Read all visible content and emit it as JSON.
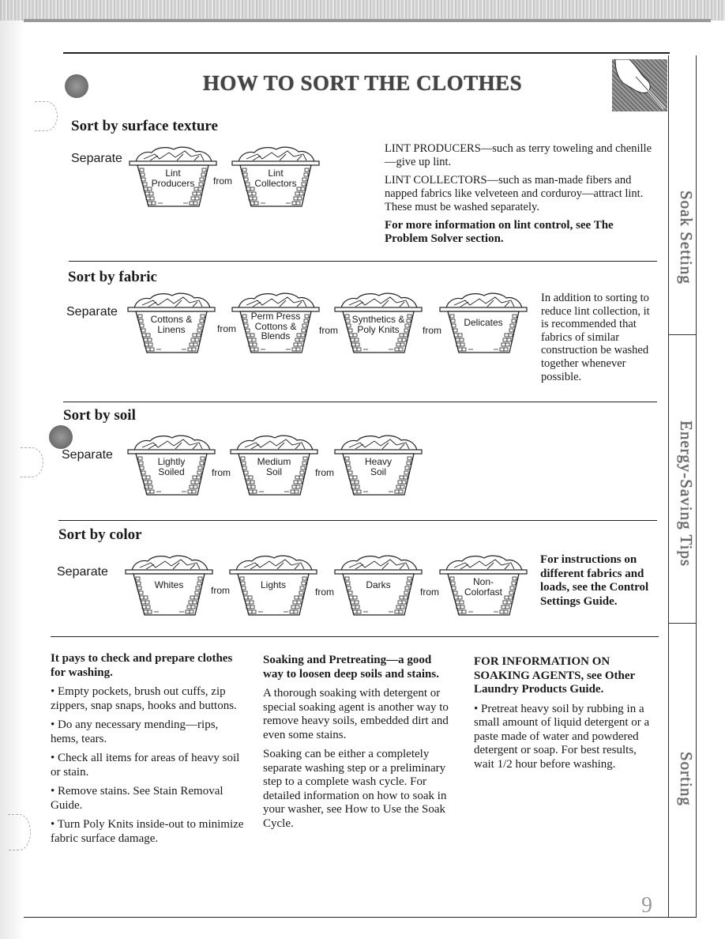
{
  "page": {
    "title": "HOW TO SORT THE CLOTHES",
    "page_number": "9"
  },
  "side_tabs": [
    "Soak Setting",
    "Energy-Saving Tips",
    "Sorting"
  ],
  "sections": {
    "surface": {
      "heading": "Sort by surface texture",
      "separate": "Separate",
      "from": "from",
      "baskets": [
        [
          "Lint",
          "Producers"
        ],
        [
          "Lint",
          "Collectors"
        ]
      ],
      "notes": [
        "LINT PRODUCERS—such as terry toweling and chenille—give up lint.",
        "LINT COLLECTORS—such as man-made fibers and napped fabrics like velveteen and corduroy—attract lint. These must be washed separately."
      ],
      "note_bold": "For more information on lint control, see The Problem Solver section."
    },
    "fabric": {
      "heading": "Sort by fabric",
      "separate": "Separate",
      "from": "from",
      "baskets": [
        [
          "Cottons &",
          "Linens"
        ],
        [
          "Perm Press",
          "Cottons &",
          "Blends"
        ],
        [
          "Synthetics &",
          "Poly Knits"
        ],
        [
          "Delicates"
        ]
      ],
      "note": "In addition to sorting to reduce lint collection, it is recommended that fabrics of similar construction be washed together whenever possible."
    },
    "soil": {
      "heading": "Sort by soil",
      "separate": "Separate",
      "from": "from",
      "baskets": [
        [
          "Lightly",
          "Soiled"
        ],
        [
          "Medium",
          "Soil"
        ],
        [
          "Heavy",
          "Soil"
        ]
      ]
    },
    "color": {
      "heading": "Sort by color",
      "separate": "Separate",
      "from": "from",
      "baskets": [
        [
          "Whites"
        ],
        [
          "Lights"
        ],
        [
          "Darks"
        ],
        [
          "Non-",
          "Colorfast"
        ]
      ],
      "note_bold": "For instructions on different fabrics and loads, see the Control Settings Guide."
    }
  },
  "columns": {
    "prepare": {
      "heading": "It pays to check and prepare clothes for washing.",
      "bullets": [
        "• Empty pockets, brush out cuffs, zip zippers, snap snaps, hooks and buttons.",
        "• Do any necessary mending—rips, hems, tears.",
        "• Check all items for areas of heavy soil or stain.",
        "• Remove stains. See Stain Removal Guide.",
        "• Turn Poly Knits inside-out to minimize fabric surface damage."
      ]
    },
    "soaking": {
      "heading": "Soaking and Pretreating—a good way to loosen deep soils and stains.",
      "paragraphs": [
        "A thorough soaking with detergent or special soaking agent is another way to remove heavy soils, embedded dirt and even some stains.",
        "Soaking can be either a completely separate washing step or a preliminary step to a complete wash cycle. For detailed information on how to soak in your washer, see How to Use the Soak Cycle."
      ]
    },
    "agents": {
      "heading": "FOR INFORMATION ON SOAKING AGENTS, see Other Laundry Products Guide.",
      "bullet": "• Pretreat heavy soil by rubbing in a small amount of liquid detergent or a paste made of water and powdered detergent or soap. For best results, wait 1/2 hour before washing."
    }
  }
}
